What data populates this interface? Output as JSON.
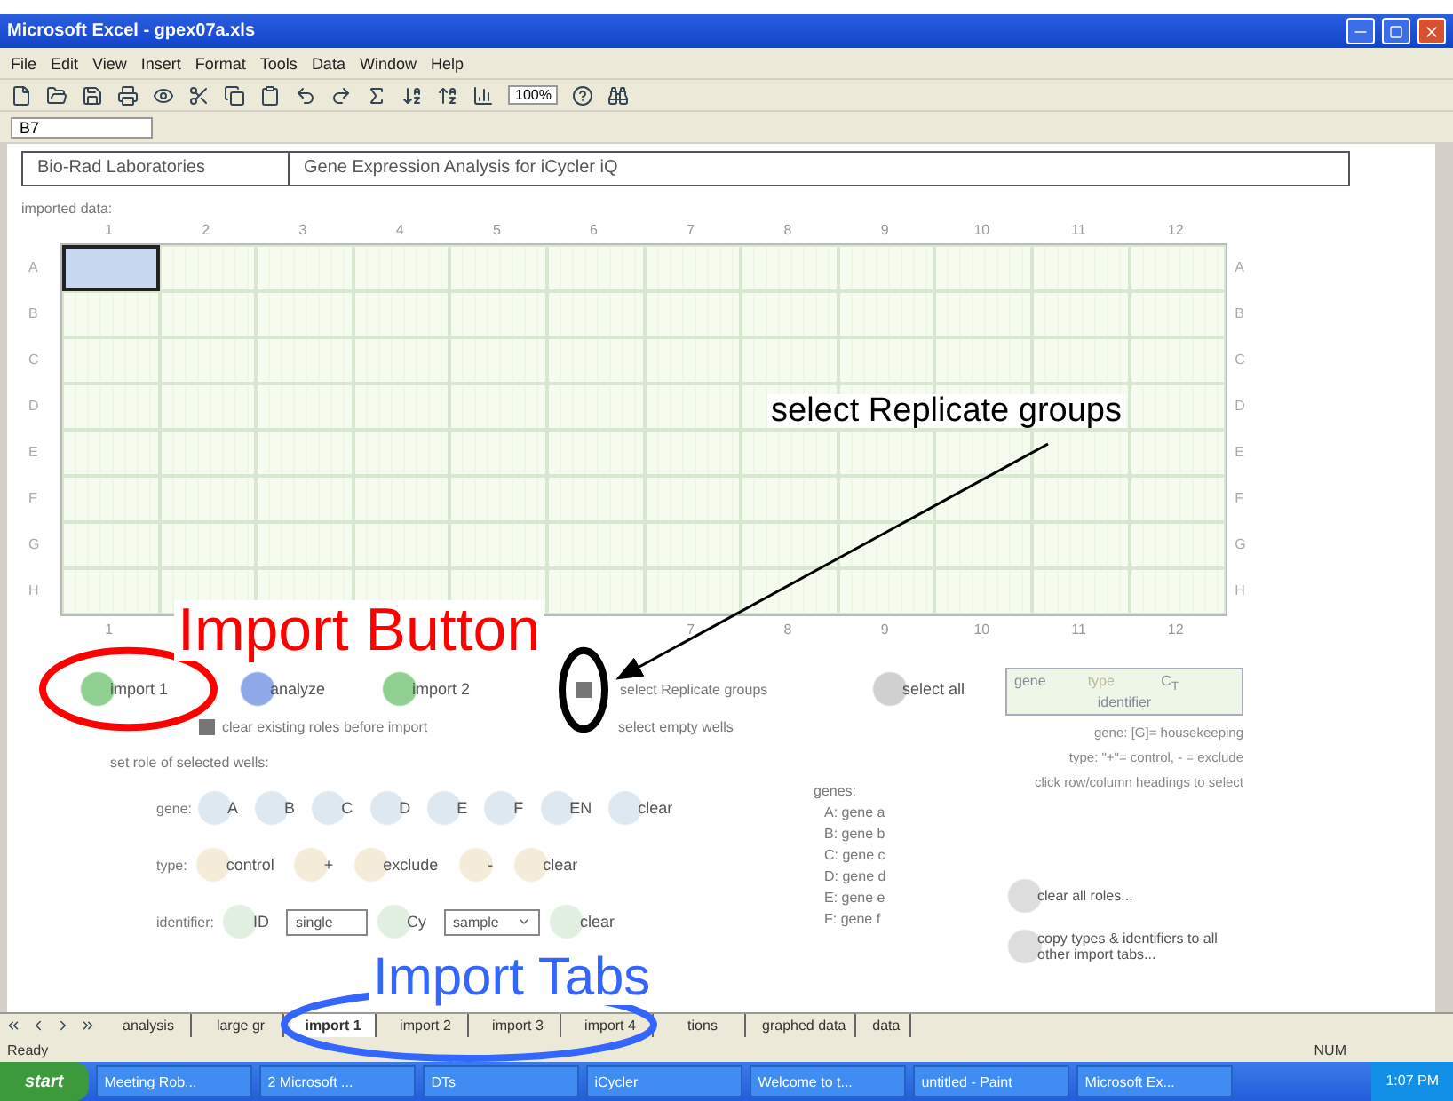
{
  "window": {
    "title": "Microsoft Excel - gpex07a.xls"
  },
  "menu": [
    "File",
    "Edit",
    "View",
    "Insert",
    "Format",
    "Tools",
    "Data",
    "Window",
    "Help"
  ],
  "toolbar": {
    "zoom": "100%"
  },
  "formula_bar": {
    "name_box": "B7"
  },
  "header": [
    "Bio-Rad Laboratories",
    "Gene Expression Analysis for iCycler iQ"
  ],
  "imported_label": "imported data:",
  "columns": [
    "1",
    "2",
    "3",
    "4",
    "5",
    "6",
    "7",
    "8",
    "9",
    "10",
    "11",
    "12"
  ],
  "right_row_labels": [
    "A",
    "B",
    "C",
    "D",
    "E",
    "F",
    "G",
    "H"
  ],
  "bottom_columns": [
    "1",
    "7",
    "8",
    "9",
    "10",
    "11",
    "12"
  ],
  "rows": [
    {
      "label": "A",
      "wells": [
        {
          "selected": true
        },
        {
          "selected": false
        },
        {
          "selected": false
        },
        {
          "selected": false
        },
        {
          "selected": false
        },
        {
          "selected": false
        },
        {
          "selected": false
        },
        {
          "selected": false
        },
        {
          "selected": false
        },
        {
          "selected": false
        },
        {
          "selected": false
        },
        {
          "selected": false
        }
      ]
    },
    {
      "label": "B",
      "wells": [
        {
          "selected": false
        },
        {
          "selected": false
        },
        {
          "selected": false
        },
        {
          "selected": false
        },
        {
          "selected": false
        },
        {
          "selected": false
        },
        {
          "selected": false
        },
        {
          "selected": false
        },
        {
          "selected": false
        },
        {
          "selected": false
        },
        {
          "selected": false
        },
        {
          "selected": false
        }
      ]
    },
    {
      "label": "C",
      "wells": [
        {
          "selected": false
        },
        {
          "selected": false
        },
        {
          "selected": false
        },
        {
          "selected": false
        },
        {
          "selected": false
        },
        {
          "selected": false
        },
        {
          "selected": false
        },
        {
          "selected": false
        },
        {
          "selected": false
        },
        {
          "selected": false
        },
        {
          "selected": false
        },
        {
          "selected": false
        }
      ]
    },
    {
      "label": "D",
      "wells": [
        {
          "selected": false
        },
        {
          "selected": false
        },
        {
          "selected": false
        },
        {
          "selected": false
        },
        {
          "selected": false
        },
        {
          "selected": false
        },
        {
          "selected": false
        },
        {
          "selected": false
        },
        {
          "selected": false
        },
        {
          "selected": false
        },
        {
          "selected": false
        },
        {
          "selected": false
        }
      ]
    },
    {
      "label": "E",
      "wells": [
        {
          "selected": false
        },
        {
          "selected": false
        },
        {
          "selected": false
        },
        {
          "selected": false
        },
        {
          "selected": false
        },
        {
          "selected": false
        },
        {
          "selected": false
        },
        {
          "selected": false
        },
        {
          "selected": false
        },
        {
          "selected": false
        },
        {
          "selected": false
        },
        {
          "selected": false
        }
      ]
    },
    {
      "label": "F",
      "wells": [
        {
          "selected": false
        },
        {
          "selected": false
        },
        {
          "selected": false
        },
        {
          "selected": false
        },
        {
          "selected": false
        },
        {
          "selected": false
        },
        {
          "selected": false
        },
        {
          "selected": false
        },
        {
          "selected": false
        },
        {
          "selected": false
        },
        {
          "selected": false
        },
        {
          "selected": false
        }
      ]
    },
    {
      "label": "G",
      "wells": [
        {
          "selected": false
        },
        {
          "selected": false
        },
        {
          "selected": false
        },
        {
          "selected": false
        },
        {
          "selected": false
        },
        {
          "selected": false
        },
        {
          "selected": false
        },
        {
          "selected": false
        },
        {
          "selected": false
        },
        {
          "selected": false
        },
        {
          "selected": false
        },
        {
          "selected": false
        }
      ]
    },
    {
      "label": "H",
      "wells": [
        {
          "selected": false
        },
        {
          "selected": false
        },
        {
          "selected": false
        },
        {
          "selected": false
        },
        {
          "selected": false
        },
        {
          "selected": false
        },
        {
          "selected": false
        },
        {
          "selected": false
        },
        {
          "selected": false
        },
        {
          "selected": false
        },
        {
          "selected": false
        },
        {
          "selected": false
        }
      ]
    }
  ],
  "actions": [
    {
      "kind": "button",
      "label": "import 1",
      "color": "#8fcf8f"
    },
    {
      "kind": "button",
      "label": "analyze",
      "color": "#8fa8e8"
    },
    {
      "kind": "button",
      "label": "import 2",
      "color": "#8fcf8f"
    },
    {
      "kind": "checkbox",
      "label": "select Replicate groups",
      "checked": true
    },
    {
      "kind": "button",
      "label": "select all",
      "color": "#d0d0d0"
    }
  ],
  "options": [
    {
      "label": "clear existing roles before import",
      "checked": true
    },
    {
      "label": "select empty wells"
    }
  ],
  "legend": {
    "gene": "gene",
    "type": "type",
    "value": "C$_{T}$",
    "identifier": "identifier"
  },
  "notes": [
    "gene: [G]= housekeeping",
    "type: \"+\"= control, - = exclude",
    "click row/column headings to select"
  ],
  "roles": {
    "title": "set role of selected wells:",
    "gene": {
      "label": "gene:",
      "buttons": [
        "A",
        "B",
        "C",
        "D",
        "E",
        "F",
        "EN",
        "clear"
      ]
    },
    "type": {
      "label": "type:",
      "buttons": [
        "control",
        "+",
        "exclude",
        "-",
        "clear"
      ]
    },
    "identifier": {
      "label": "identifier:",
      "id_button": "ID",
      "value": "single",
      "cy_button": "Cy",
      "dropdown": "sample",
      "clear": "clear"
    }
  },
  "genes": {
    "title": "genes:",
    "items": [
      "A: gene a",
      "B: gene b",
      "C: gene c",
      "D: gene d",
      "E: gene e",
      "F: gene f"
    ]
  },
  "side_buttons": [
    "clear all roles...",
    "copy types & identifiers to all other import tabs..."
  ],
  "sheet_tabs": [
    {
      "label": "analysis",
      "selected": false
    },
    {
      "label": "large gr",
      "selected": false
    },
    {
      "label": "import 1",
      "selected": true
    },
    {
      "label": "import 2",
      "selected": false
    },
    {
      "label": "import 3",
      "selected": false
    },
    {
      "label": "import 4",
      "selected": false
    },
    {
      "label": "tions",
      "selected": false
    },
    {
      "label": "graphed data",
      "selected": false
    },
    {
      "label": "data",
      "selected": false
    }
  ],
  "status_bar": {
    "left": "Ready",
    "right": "NUM"
  },
  "taskbar": {
    "start": "start",
    "items": [
      "Meeting Rob...",
      "2 Microsoft ...",
      "DTs",
      "iCycler",
      "Welcome to t...",
      "untitled - Paint",
      "Microsoft Ex..."
    ],
    "clock": "1:07 PM"
  },
  "annotations": [
    {
      "kind": "label",
      "text": "Import Button",
      "color": "#ff0000"
    },
    {
      "kind": "ellipse",
      "color": "#ff0000"
    },
    {
      "kind": "label",
      "text": "select Replicate groups",
      "color": "#000000"
    },
    {
      "kind": "arrow",
      "color": "#000000"
    },
    {
      "kind": "ellipse",
      "color": "#000000"
    },
    {
      "kind": "label",
      "text": "Import Tabs",
      "color": "#3366ff"
    },
    {
      "kind": "ellipse",
      "color": "#3366ff"
    }
  ]
}
